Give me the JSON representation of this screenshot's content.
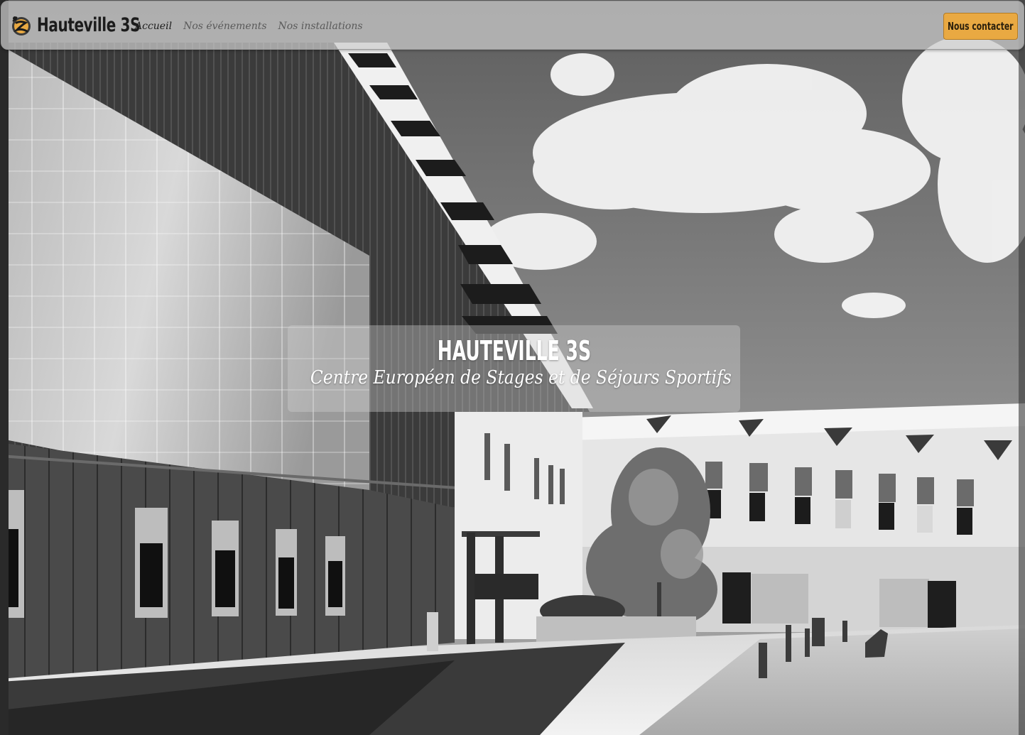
{
  "navbar": {
    "brand_name": "Hauteville 3S",
    "links": [
      {
        "label": "Accueil",
        "active": true
      },
      {
        "label": "Nos événements",
        "active": false
      },
      {
        "label": "Nos installations",
        "active": false
      }
    ],
    "contact_label": "Nous contacter"
  },
  "hero": {
    "title": "HAUTEVILLE 3S",
    "subtitle": "Centre Européen de Stages et de Séjours Sportifs"
  },
  "colors": {
    "accent": "#e9a942",
    "navbar_bg": "#cdcdcd",
    "text_dark": "#1c1c1c"
  },
  "icons": {
    "brand_logo": "sports-emblem-icon"
  }
}
